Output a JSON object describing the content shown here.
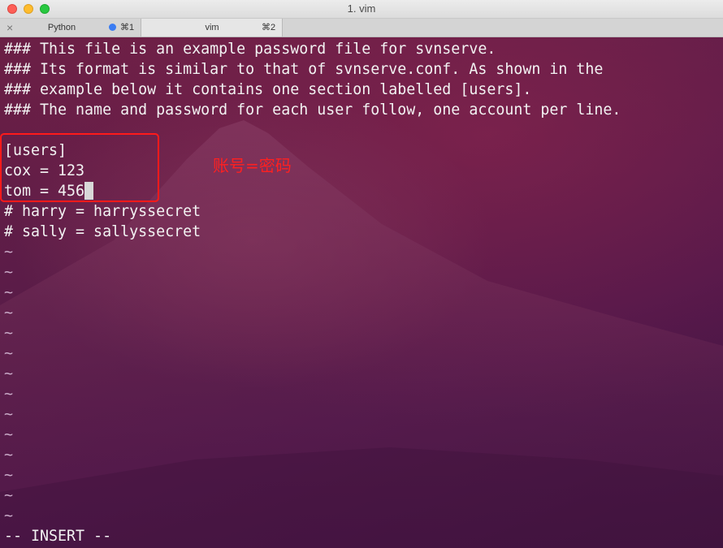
{
  "window": {
    "title": "1. vim"
  },
  "tabs": [
    {
      "label": "Python",
      "shortcut": "⌘1",
      "close_icon": "×"
    },
    {
      "label": "vim",
      "shortcut": "⌘2",
      "close_icon": "×"
    }
  ],
  "editor": {
    "lines": [
      "### This file is an example password file for svnserve.",
      "### Its format is similar to that of svnserve.conf. As shown in the",
      "### example below it contains one section labelled [users].",
      "### The name and password for each user follow, one account per line.",
      "",
      "[users]",
      "cox = 123",
      "tom = 456",
      "# harry = harryssecret",
      "# sally = sallyssecret"
    ],
    "tilde": "~",
    "tilde_count": 14,
    "mode": "-- INSERT --"
  },
  "annotation": {
    "text": "账号=密码",
    "color": "#ff2020"
  },
  "colors": {
    "text": "#f2f2f2",
    "annotation_box": "#ff1a1a",
    "tab_activity_dot": "#3a7cf2"
  }
}
